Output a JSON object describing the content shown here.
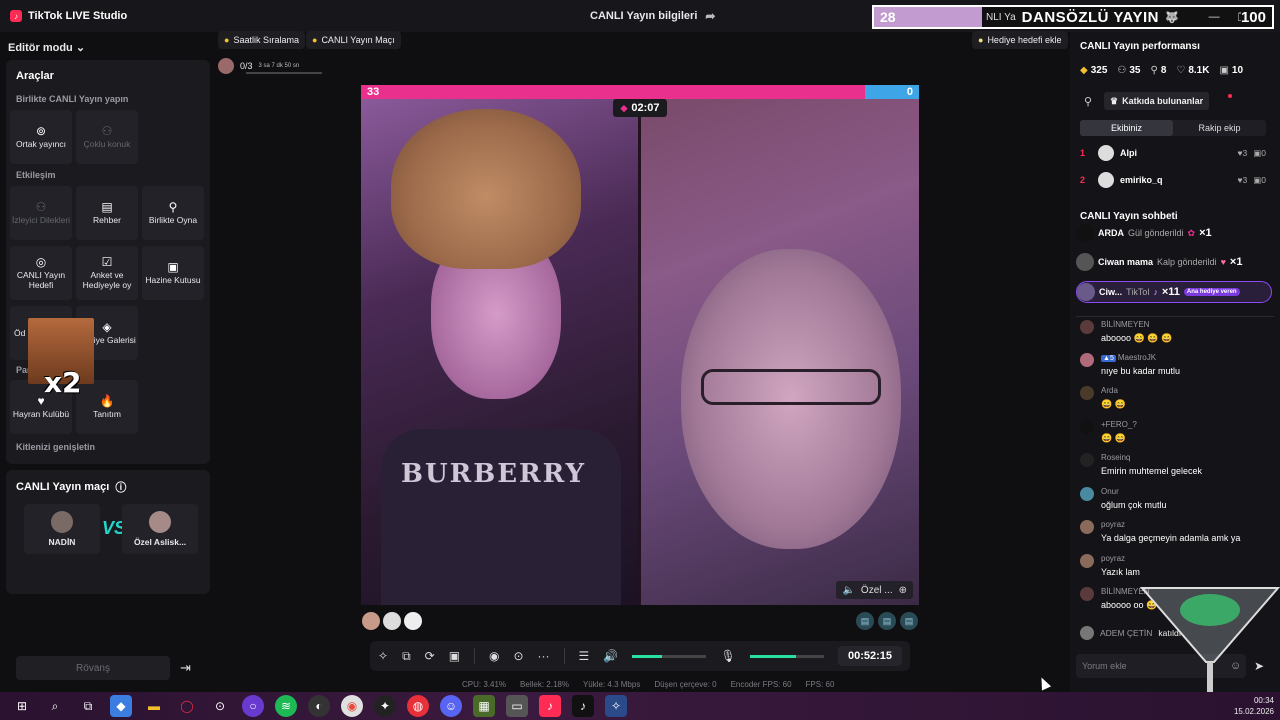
{
  "app": {
    "title": "TikTok LIVE Studio",
    "center_title": "CANLI Yayın bilgileri"
  },
  "overlay": {
    "left_number": "28",
    "small_text": "NLI Ya",
    "big_text": "DANSÖZLÜ YAYIN",
    "right_number": "100"
  },
  "left_panel": {
    "editor_mode": "Editör modu",
    "tools_title": "Araçlar",
    "section_together": "Birlikte CANLI Yayın yapın",
    "section_interaction": "Etkileşim",
    "section_fans_short": "Par",
    "section_grow": "Kitlenizi genişletin",
    "tools": {
      "co_host": "Ortak yayıncı",
      "multi_guest": "Çoklu konuk",
      "viewer_requests": "İzleyici Dilekleri",
      "guide": "Rehber",
      "play_together": "Birlikte Oyna",
      "live_goal": "CANLI Yayın Hedefi",
      "poll": "Anket ve Hediyeyle oy",
      "treasure": "Hazine Kutusu",
      "rewards_short": "Öd",
      "gift_gallery": "Hediye Galerisi",
      "fan_club": "Hayran Kulübü",
      "promotion": "Tanıtım"
    },
    "sticker_text": "x2",
    "match_title": "CANLI Yayın maçı",
    "match_left": "NADİN",
    "match_vs": "VS",
    "match_right": "Özel Aslisk...",
    "rematch": "Rövanş"
  },
  "top_chips": {
    "hourly_ranking": "Saatlik Sıralama",
    "live_match": "CANLI Yayın Maçı",
    "gift_goal": "Hediye hedefi ekle"
  },
  "progress_mini": {
    "count": "0/3",
    "time": "3 sa 7 dk 50 sn"
  },
  "video": {
    "score_left": "33",
    "score_right": "0",
    "timer": "02:07",
    "right_label": "Özel ...",
    "shirt_text": "BURBERRY"
  },
  "controls": {
    "speaker_level": 0.4,
    "mic_level": 0.62,
    "elapsed": "00:52:15"
  },
  "stats": {
    "cpu": "CPU: 3.41%",
    "memory": "Bellek: 2.18%",
    "upload": "Yükle: 4.3 Mbps",
    "dropped": "Düşen çerçeve: 0",
    "encoder_fps": "Encoder FPS: 60",
    "fps": "FPS: 60"
  },
  "right_panel": {
    "perf_title": "CANLI Yayın performansı",
    "perf": {
      "diamonds": "325",
      "viewers": "35",
      "followers": "8",
      "likes": "8.1K",
      "gifts": "10"
    },
    "contributors_btn": "Katkıda bulunanlar",
    "tab_team": "Ekibiniz",
    "tab_rival": "Rakip ekip",
    "ranks": [
      {
        "num": "1",
        "name": "Alpi",
        "likes": "3",
        "gifts": "0"
      },
      {
        "num": "2",
        "name": "emiriko_q",
        "likes": "3",
        "gifts": "0"
      }
    ],
    "chat_title": "CANLI Yayın sohbeti",
    "gifts": [
      {
        "name": "ARDA",
        "action": "Gül gönderildi",
        "count": "×1"
      },
      {
        "name": "Ciwan mama",
        "action": "Kalp gönderildi",
        "count": "×1"
      },
      {
        "name": "Ciw...",
        "action": "TikTol",
        "count": "×11",
        "badge": "Ana hediye veren"
      }
    ],
    "messages": [
      {
        "name": "BİLİNMEYEN",
        "text": "aboooo 😄 😄 😄",
        "level": ""
      },
      {
        "name": "MaestroJK",
        "text": "nıye bu kadar mutlu",
        "level": "5"
      },
      {
        "name": "Arda",
        "text": "😄 😄",
        "level": ""
      },
      {
        "name": "+FERO_?",
        "text": "😄 😄",
        "level": ""
      },
      {
        "name": "Roseinq",
        "text": "Emirin muhtemel gelecek",
        "level": ""
      },
      {
        "name": "Onur",
        "text": "oğlum çok mutlu",
        "level": ""
      },
      {
        "name": "poyraz",
        "text": "Ya dalga geçmeyin adamla amk ya",
        "level": ""
      },
      {
        "name": "poyraz",
        "text": "Yazık lam",
        "level": ""
      },
      {
        "name": "BİLİNMEYEN",
        "text": "aboooo oo 😄",
        "level": ""
      }
    ],
    "join_name": "ADEM ÇETİN",
    "join_action": "katıldı",
    "comment_placeholder": "Yorum ekle"
  },
  "taskbar": {
    "time": "00:34",
    "date": "15.02.2026"
  }
}
